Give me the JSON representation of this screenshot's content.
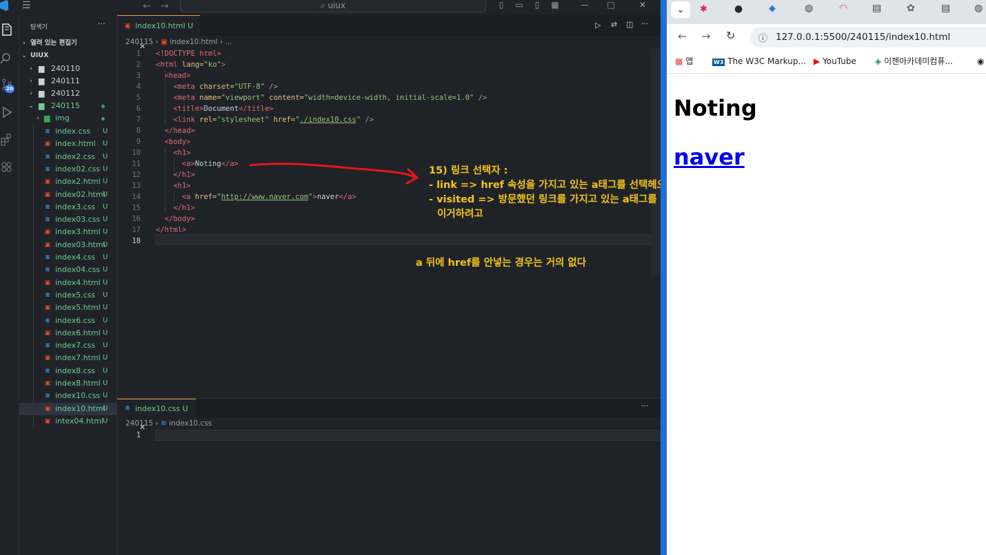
{
  "vscode": {
    "command_center": "uiux",
    "sidebar": {
      "title": "탐색기",
      "open_editors": "열려 있는 편집기",
      "root": "UIUX",
      "folders": [
        "240110",
        "240111",
        "240112",
        "240115"
      ],
      "img_folder": "img",
      "files": [
        {
          "name": "index.css",
          "type": "css",
          "status": "U"
        },
        {
          "name": "index.html",
          "type": "html",
          "status": "U"
        },
        {
          "name": "index2.css",
          "type": "css",
          "status": "U"
        },
        {
          "name": "index02.css",
          "type": "css",
          "status": "U"
        },
        {
          "name": "index2.html",
          "type": "html",
          "status": "U"
        },
        {
          "name": "index02.html",
          "type": "html",
          "status": "U"
        },
        {
          "name": "index3.css",
          "type": "css",
          "status": "U"
        },
        {
          "name": "index03.css",
          "type": "css",
          "status": "U"
        },
        {
          "name": "index3.html",
          "type": "html",
          "status": "U"
        },
        {
          "name": "index03.html",
          "type": "html",
          "status": "U"
        },
        {
          "name": "index4.css",
          "type": "css",
          "status": "U"
        },
        {
          "name": "index04.css",
          "type": "css",
          "status": "U"
        },
        {
          "name": "index4.html",
          "type": "html",
          "status": "U"
        },
        {
          "name": "index5.css",
          "type": "css",
          "status": "U"
        },
        {
          "name": "index5.html",
          "type": "html",
          "status": "U"
        },
        {
          "name": "index6.css",
          "type": "css",
          "status": "U"
        },
        {
          "name": "index6.html",
          "type": "html",
          "status": "U"
        },
        {
          "name": "index7.css",
          "type": "css",
          "status": "U"
        },
        {
          "name": "index7.html",
          "type": "html",
          "status": "U"
        },
        {
          "name": "index8.css",
          "type": "css",
          "status": "U"
        },
        {
          "name": "index8.html",
          "type": "html",
          "status": "U"
        },
        {
          "name": "index10.css",
          "type": "css",
          "status": "U"
        },
        {
          "name": "index10.html",
          "type": "html",
          "status": "U"
        },
        {
          "name": "intex04.html",
          "type": "html",
          "status": "U"
        }
      ],
      "scm_badge": "26"
    },
    "editor_top": {
      "tab_label": "index10.html",
      "tab_status": "U",
      "breadcrumb_folder": "240115",
      "breadcrumb_file": "index10.html",
      "breadcrumb_more": "...",
      "line_numbers": [
        "1",
        "2",
        "3",
        "4",
        "5",
        "6",
        "7",
        "8",
        "9",
        "10",
        "11",
        "12",
        "13",
        "14",
        "15",
        "16",
        "17",
        "18"
      ],
      "code": {
        "l1": "<!DOCTYPE html>",
        "l2_open": "<html",
        "l2_attr": " lang=",
        "l2_val": "\"ko\"",
        "l2_close": ">",
        "l3": "<head>",
        "l4_tag": "<meta",
        "l4_attr": " charset=",
        "l4_val": "\"UTF-8\"",
        "l4_end": " />",
        "l5_tag": "<meta",
        "l5_attr1": " name=",
        "l5_val1": "\"viewport\"",
        "l5_attr2": " content=",
        "l5_val2": "\"width=device-width, initial-scale=1.0\"",
        "l5_end": " />",
        "l6_open": "<title>",
        "l6_text": "Document",
        "l6_close": "</title>",
        "l7_tag": "<link",
        "l7_attr1": " rel=",
        "l7_val1": "\"stylesheet\"",
        "l7_attr2": " href=",
        "l7_val2a": "\"",
        "l7_val2b": "./index10.css",
        "l7_val2c": "\"",
        "l7_end": " />",
        "l8": "</head>",
        "l9": "<body>",
        "l10": "<h1>",
        "l11_open": "<a>",
        "l11_text": "Noting",
        "l11_close": "</a>",
        "l12": "</h1>",
        "l13": "<h1>",
        "l14_tag": "<a",
        "l14_attr": " href=",
        "l14_val1": "\"",
        "l14_val2": "http://www.naver.com",
        "l14_val3": "\"",
        "l14_gt": ">",
        "l14_text": "naver",
        "l14_close": "</a>",
        "l15": "</h1>",
        "l16": "</body>",
        "l17": "</html>"
      }
    },
    "editor_bottom": {
      "tab_label": "index10.css",
      "tab_status": "U",
      "breadcrumb_folder": "240115",
      "breadcrumb_file": "index10.css",
      "line_number": "1"
    },
    "annotations": {
      "title": "15) 링크 선택자 :",
      "line1": "- link => href 속성을 가지고 있는 a태그를 선택헤오고자 할 때",
      "line2": "- visited => 방문했던 링크를 가지고 있는 a태그를 선택헤오고자 할 때",
      "line3": "이거하려고",
      "note": "a 뒤에 href를 안넣는 경우는 거의 없다",
      "color": "#f5c518",
      "arrow_color": "#e8161b"
    }
  },
  "browser": {
    "url": "127.0.0.1:5500/240115/index10.html",
    "bookmarks": [
      "앱",
      "The W3C Markup...",
      "YouTube",
      "이젠아카데미컴퓨..."
    ],
    "page": {
      "heading": "Noting",
      "link": "naver"
    }
  }
}
